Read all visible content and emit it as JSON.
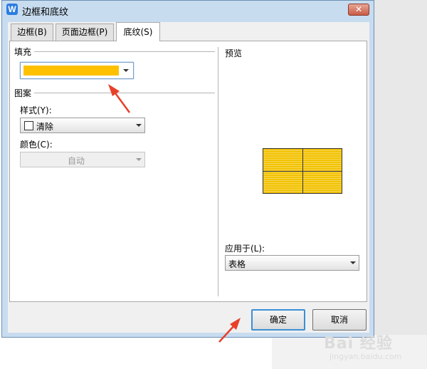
{
  "window": {
    "title": "边框和底纹",
    "app_icon_letter": "W",
    "close_label": "✕"
  },
  "tabs": [
    {
      "label": "边框(B)",
      "active": false
    },
    {
      "label": "页面边框(P)",
      "active": false
    },
    {
      "label": "底纹(S)",
      "active": true
    }
  ],
  "fill": {
    "section_label": "填充",
    "color": "#ffc000"
  },
  "pattern": {
    "section_label": "图案",
    "style_label": "样式(Y):",
    "style_value": "清除",
    "color_label": "颜色(C):",
    "color_value": "自动"
  },
  "preview": {
    "label": "预览",
    "fill_color": "#f2c200"
  },
  "apply": {
    "label": "应用于(L):",
    "value": "表格"
  },
  "buttons": {
    "ok": "确定",
    "cancel": "取消"
  },
  "watermark": {
    "text": "Bai 经验",
    "sub": "jingyan.baidu.com"
  },
  "colors": {
    "dialog_frame": "#c8dcf0",
    "annotation_arrow": "#e8402a"
  }
}
